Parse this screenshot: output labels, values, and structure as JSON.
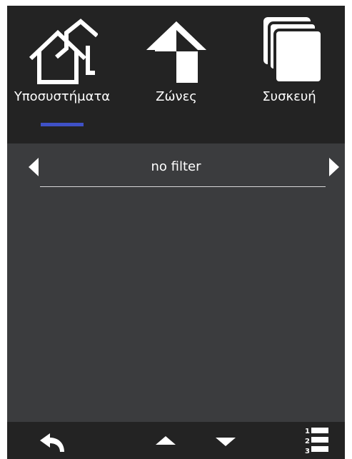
{
  "tabs": [
    {
      "label": "Υποσυστήματα",
      "icon": "houses-icon",
      "active": true
    },
    {
      "label": "Ζώνες",
      "icon": "zone-house-icon",
      "active": false
    },
    {
      "label": "Συσκευή",
      "icon": "stacked-pages-icon",
      "active": false
    }
  ],
  "filter": {
    "label": "no filter",
    "prev_icon": "chevron-left-icon",
    "next_icon": "chevron-right-icon"
  },
  "bottom_bar": {
    "back_icon": "back-arrow-icon",
    "up_icon": "arrow-up-icon",
    "down_icon": "arrow-down-icon",
    "list_icon": "numbered-list-icon",
    "list_numbers": [
      "1",
      "2",
      "3"
    ]
  },
  "colors": {
    "top_bar": "#232323",
    "content": "#3b3c3e",
    "accent": "#3f51c6",
    "text": "#ffffff"
  }
}
